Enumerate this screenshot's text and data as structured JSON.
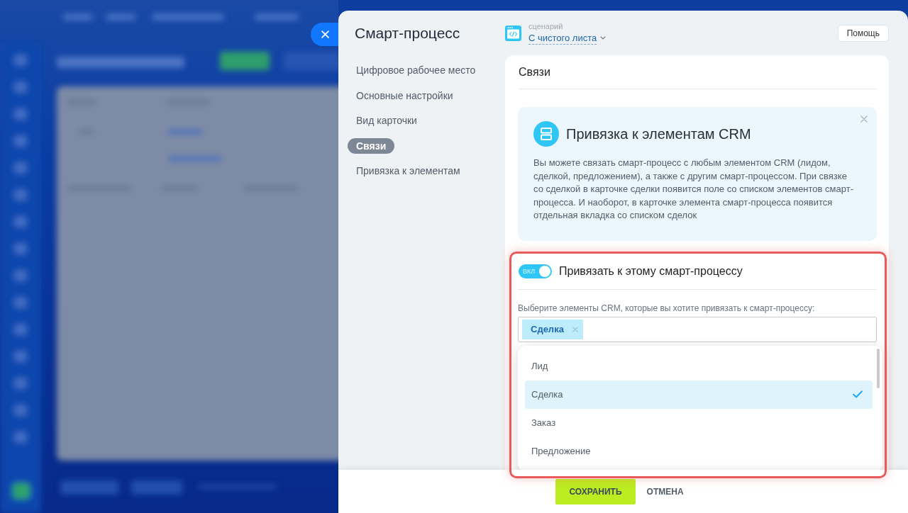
{
  "panel": {
    "title": "Смарт-процесс",
    "scenario": {
      "caption": "сценарий",
      "value": "С чистого листа"
    },
    "help_button": "Помощь"
  },
  "sidebar": {
    "items": [
      {
        "label": "Цифровое рабочее место",
        "selected": false
      },
      {
        "label": "Основные настройки",
        "selected": false
      },
      {
        "label": "Вид карточки",
        "selected": false
      },
      {
        "label": "Связи",
        "selected": true
      },
      {
        "label": "Привязка к элементам",
        "selected": false
      }
    ]
  },
  "section": {
    "title": "Связи"
  },
  "info_card": {
    "title": "Привязка к элементам CRM",
    "text": "Вы можете связать смарт-процесс с любым элементом CRM (лидом, сделкой, предложением), а также с другим смарт-процессом. При связке со сделкой в карточке сделки появится поле со списком элементов смарт-процесса. И наоборот, в карточке элемента смарт-процесса появится отдельная вкладка со списком сделок"
  },
  "binding": {
    "toggle": {
      "text": "ВКЛ",
      "on": true
    },
    "title": "Привязать к этому смарт-процессу",
    "field_label": "Выберите элементы CRM, которые вы хотите привязать к смарт-процессу:",
    "tags": [
      "Сделка"
    ],
    "dropdown": {
      "items": [
        {
          "label": "Лид",
          "selected": false
        },
        {
          "label": "Сделка",
          "selected": true
        },
        {
          "label": "Заказ",
          "selected": false
        },
        {
          "label": "Предложение",
          "selected": false
        }
      ]
    }
  },
  "footer": {
    "buttons": [
      {
        "label": "СОХРАНИТЬ",
        "kind": "primary"
      },
      {
        "label": "ОТМЕНА",
        "kind": "secondary"
      }
    ]
  }
}
